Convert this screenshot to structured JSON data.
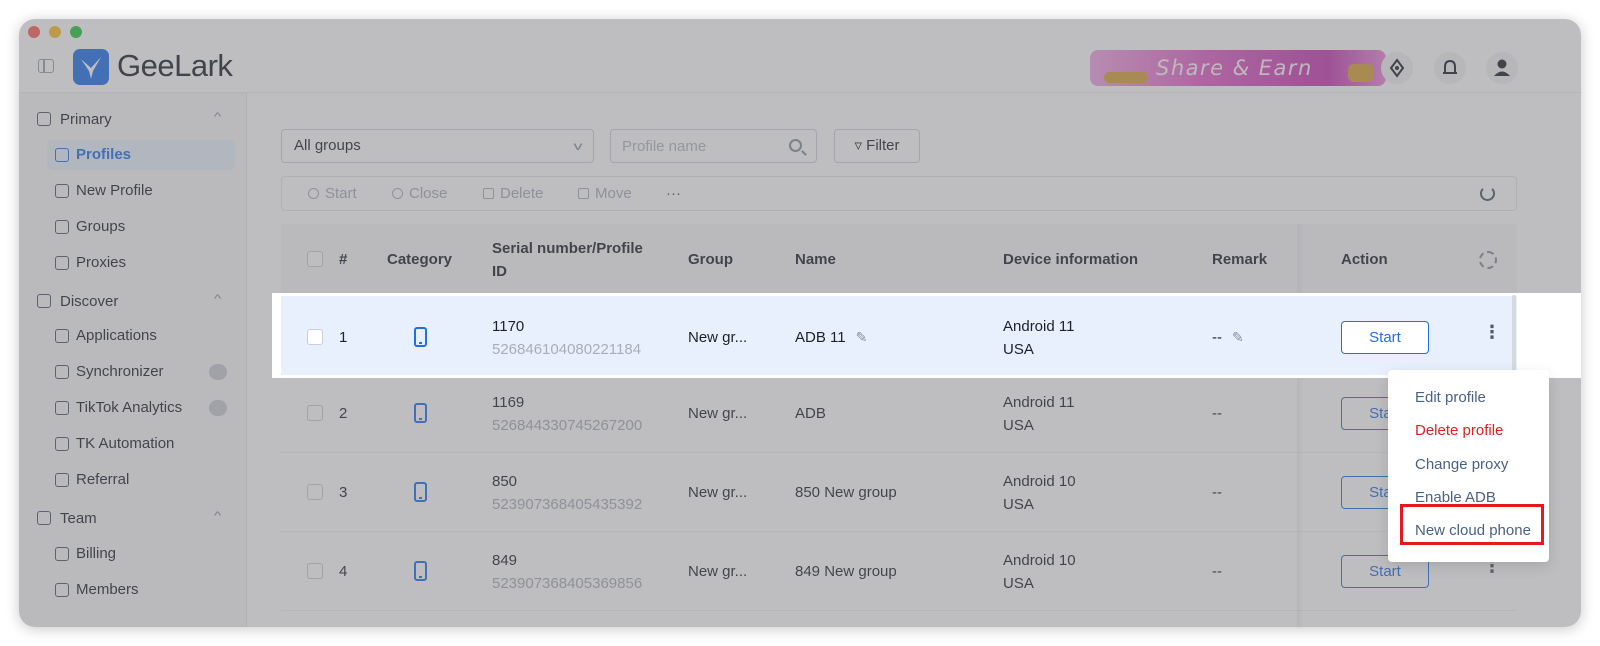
{
  "app": {
    "brand": "GeeLark",
    "promo": "Share & Earn"
  },
  "header": {
    "icons": [
      "launch-icon",
      "bell-icon",
      "user-icon"
    ]
  },
  "sidebar": {
    "primary": {
      "label": "Primary",
      "icon": "home-icon"
    },
    "primary_items": [
      {
        "label": "Profiles",
        "icon": "profiles-icon",
        "active": true
      },
      {
        "label": "New Profile",
        "icon": "edit-icon"
      },
      {
        "label": "Groups",
        "icon": "list-icon"
      },
      {
        "label": "Proxies",
        "icon": "proxy-icon"
      }
    ],
    "discover": {
      "label": "Discover",
      "icon": "discover-icon"
    },
    "discover_items": [
      {
        "label": "Applications",
        "icon": "applications-icon"
      },
      {
        "label": "Synchronizer",
        "icon": "synchronizer-icon"
      },
      {
        "label": "TikTok Analytics",
        "icon": "chart-icon"
      },
      {
        "label": "TK Automation",
        "icon": "tiktok-icon"
      },
      {
        "label": "Referral",
        "icon": "gift-icon"
      }
    ],
    "team": {
      "label": "Team",
      "icon": "team-icon"
    },
    "team_items": [
      {
        "label": "Billing",
        "icon": "billing-icon"
      },
      {
        "label": "Members",
        "icon": "members-icon"
      }
    ]
  },
  "filters": {
    "group_select": "All groups",
    "search_placeholder": "Profile name",
    "filter_label": "Filter"
  },
  "toolbar": {
    "start": "Start",
    "close": "Close",
    "delete": "Delete",
    "move": "Move",
    "more": "···"
  },
  "table": {
    "headers": {
      "index": "#",
      "category": "Category",
      "serial_line1": "Serial number/Profile",
      "serial_line2": "ID",
      "group": "Group",
      "name": "Name",
      "device": "Device information",
      "remark": "Remark",
      "action": "Action"
    },
    "rows": [
      {
        "index": "1",
        "serial": "1170",
        "profile_id": "526846104080221184",
        "group": "New gr...",
        "name": "ADB 11",
        "os": "Android 11",
        "country": "USA",
        "remark": "--",
        "action": "Start"
      },
      {
        "index": "2",
        "serial": "1169",
        "profile_id": "526844330745267200",
        "group": "New gr...",
        "name": "ADB",
        "os": "Android 11",
        "country": "USA",
        "remark": "--",
        "action": "Start"
      },
      {
        "index": "3",
        "serial": "850",
        "profile_id": "523907368405435392",
        "group": "New gr...",
        "name": "850 New group",
        "os": "Android 10",
        "country": "USA",
        "remark": "--",
        "action": "Start"
      },
      {
        "index": "4",
        "serial": "849",
        "profile_id": "523907368405369856",
        "group": "New gr...",
        "name": "849 New group",
        "os": "Android 10",
        "country": "USA",
        "remark": "--",
        "action": "Start"
      }
    ]
  },
  "context_menu": {
    "items": [
      "Edit profile",
      "Delete profile",
      "Change proxy",
      "Enable ADB",
      "New cloud phone"
    ],
    "highlighted": "New cloud phone",
    "danger_color": "#e02020",
    "highlight_color": "#e3191b"
  },
  "colors": {
    "accent": "#1f6feb",
    "row_highlight": "#e8f0fd"
  }
}
